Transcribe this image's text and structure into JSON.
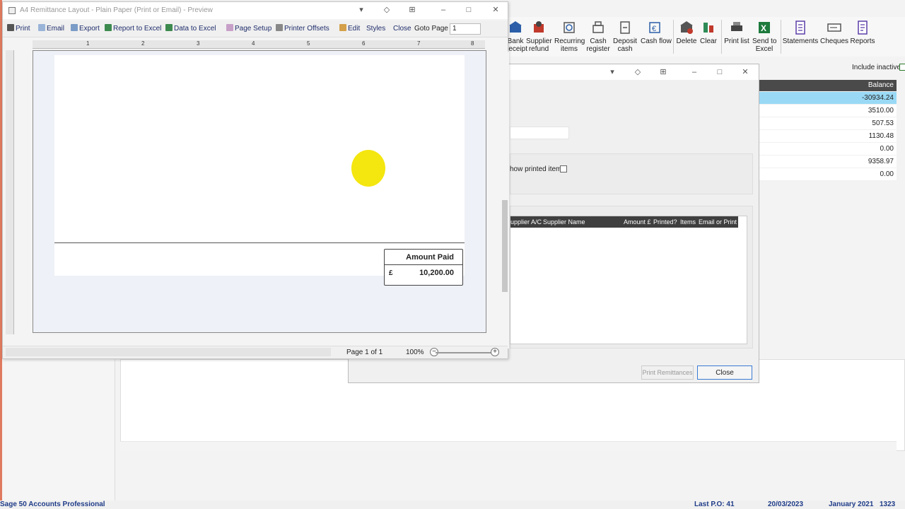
{
  "preview_window": {
    "title": "A4 Remittance Layout - Plain Paper (Print or Email) - Preview",
    "toolbar": {
      "print": "Print",
      "email": "Email",
      "export": "Export",
      "report_to_excel": "Report to Excel",
      "data_to_excel": "Data to Excel",
      "page_setup": "Page Setup",
      "printer_offsets": "Printer Offsets",
      "edit": "Edit",
      "styles": "Styles",
      "close": "Close",
      "goto_page": "Goto Page",
      "goto_value": "1"
    },
    "ruler": [
      "1",
      "2",
      "3",
      "4",
      "5",
      "6",
      "7",
      "8"
    ],
    "amount_paid_label": "Amount Paid",
    "currency_symbol": "£",
    "amount_value": "10,200.00",
    "page_of": "Page 1 of 1",
    "zoom": "100%"
  },
  "main_toolbar": [
    {
      "label": "Bank\nreceipt",
      "icon": "bank-icon"
    },
    {
      "label": "Supplier\nrefund",
      "icon": "refund-icon"
    },
    {
      "label": "Recurring\nitems",
      "icon": "recurring-icon"
    },
    {
      "label": "Cash\nregister",
      "icon": "register-icon"
    },
    {
      "label": "Deposit\ncash",
      "icon": "deposit-icon"
    },
    {
      "label": "Cash flow",
      "icon": "cashflow-icon"
    },
    {
      "label": "Delete",
      "icon": "delete-icon"
    },
    {
      "label": "Clear",
      "icon": "clear-icon"
    },
    {
      "label": "Print list",
      "icon": "printer-icon"
    },
    {
      "label": "Send to\nExcel",
      "icon": "excel-icon"
    },
    {
      "label": "Statements",
      "icon": "statements-icon"
    },
    {
      "label": "Cheques",
      "icon": "cheques-icon"
    },
    {
      "label": "Reports",
      "icon": "reports-icon"
    }
  ],
  "grid": {
    "include_inactive": "Include inactive",
    "balance_header": "Balance",
    "balances": [
      "-30934.24",
      "3510.00",
      "507.53",
      "1130.48",
      "0.00",
      "9358.97",
      "0.00"
    ]
  },
  "remit_dialog": {
    "show_printed": "how printed items",
    "list_headers": {
      "supplier_ac": "upplier A/C",
      "supplier_name": "Supplier Name",
      "amount": "Amount £",
      "printed": "Printed?",
      "items": "Items",
      "email_or_print": "Email or Print"
    },
    "print_remittances": "Print Remittances",
    "close": "Close"
  },
  "status_bar": {
    "app_name": "Sage 50 Accounts Professional",
    "last_po": "Last P.O: 41",
    "date": "20/03/2023",
    "period": "January 2021",
    "number": "1323"
  },
  "colors": {
    "accent_blue": "#1f2d6b",
    "selected_row": "#99d9f5",
    "highlight": "#f4e60f"
  }
}
